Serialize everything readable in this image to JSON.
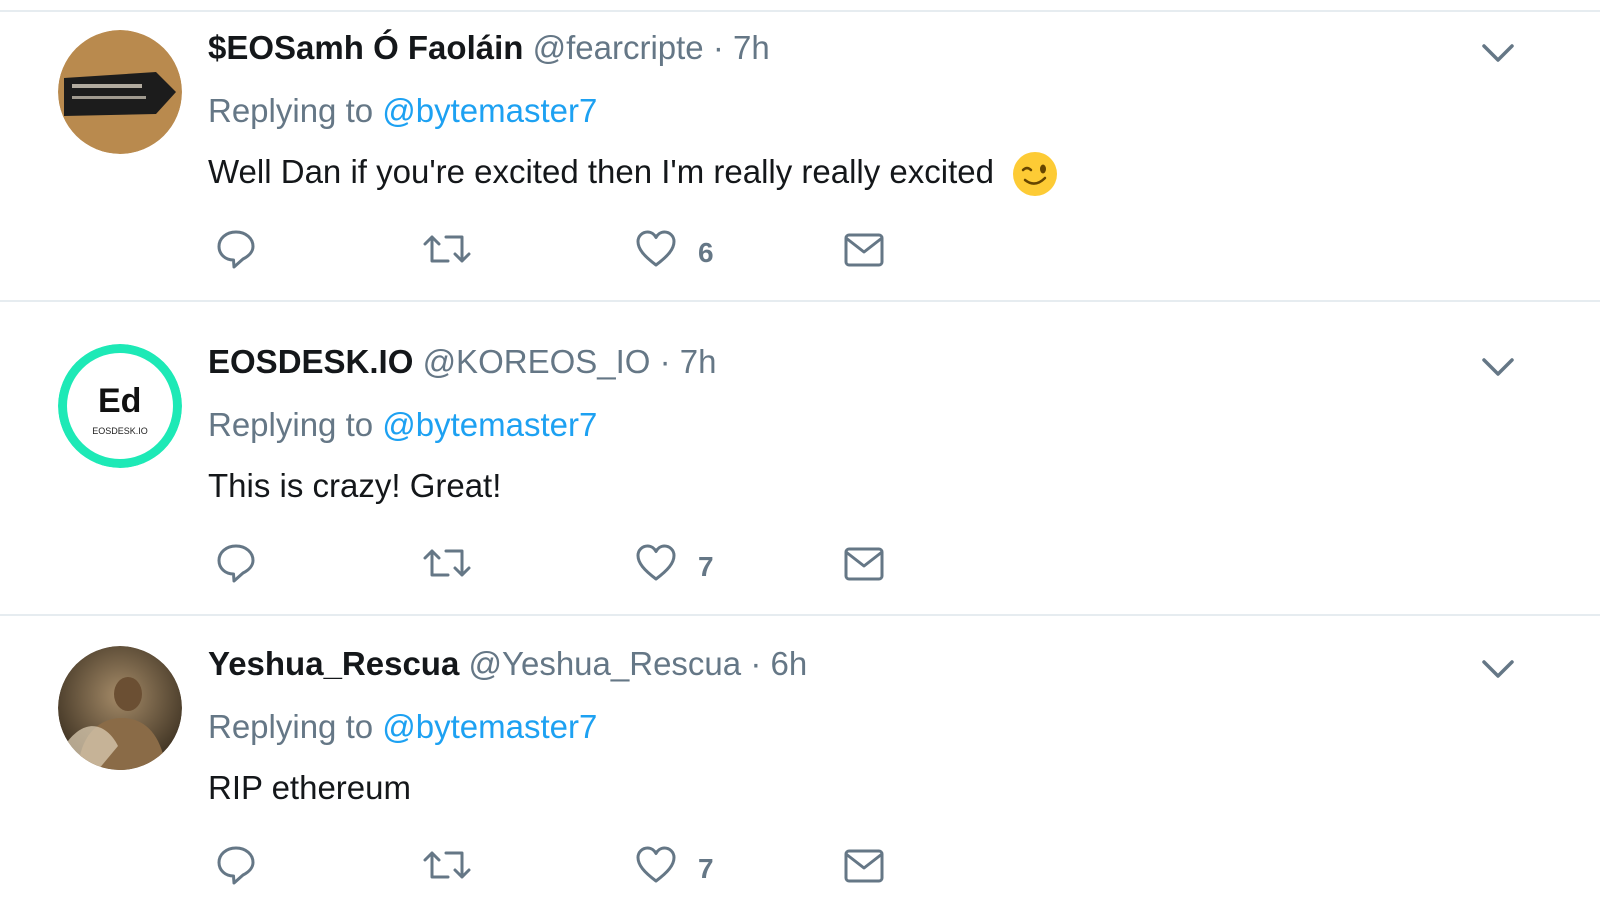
{
  "tweets": [
    {
      "display_name": "EOSDESK.IO",
      "handle": "@KOREOS_IO",
      "separator": "·",
      "time": "7h",
      "replying_prefix": "Replying to",
      "replying_to": "@bytemaster7",
      "text": "This is crazy! Great!",
      "likes": "7",
      "avatar_text": "EOSDESK.IO",
      "avatar_logo": "Ed",
      "avatar_ring_color": "#1de9b6"
    },
    {
      "display_name": "Yeshua_Rescua",
      "handle": "@Yeshua_Rescua",
      "separator": "·",
      "time": "6h",
      "replying_prefix": "Replying to",
      "replying_to": "@bytemaster7",
      "text": "RIP ethereum",
      "likes": "7"
    },
    {
      "display_name": "$EOSamh Ó Faoláin",
      "handle": "@fearcripte",
      "separator": "·",
      "time": "7h",
      "replying_prefix": "Replying to",
      "replying_to": "@bytemaster7",
      "text": "Well Dan if you're excited then I'm really really excited",
      "likes": "6"
    }
  ],
  "icons": {
    "reply": "reply-icon",
    "retweet": "retweet-icon",
    "like": "heart-icon",
    "dm": "envelope-icon",
    "caret": "chevron-down-icon",
    "emoji": "winking-face-emoji"
  },
  "colors": {
    "link": "#1da1f2",
    "secondary_text": "#657786",
    "primary_text": "#14171a",
    "divider": "#e6ecf0"
  }
}
